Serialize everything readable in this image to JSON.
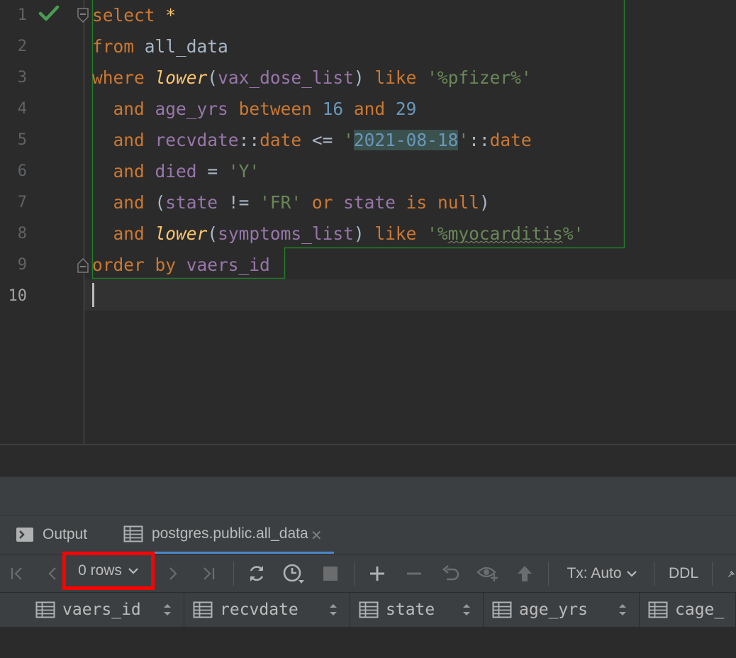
{
  "editor": {
    "line_numbers": [
      "1",
      "2",
      "3",
      "4",
      "5",
      "6",
      "7",
      "8",
      "9",
      "10"
    ],
    "lines": [
      [
        {
          "t": "select",
          "c": "kw"
        },
        {
          "t": " ",
          "c": "op"
        },
        {
          "t": "*",
          "c": "star"
        }
      ],
      [
        {
          "t": "from",
          "c": "kw"
        },
        {
          "t": " all_data",
          "c": "tbl"
        }
      ],
      [
        {
          "t": "where",
          "c": "kw"
        },
        {
          "t": " ",
          "c": "op"
        },
        {
          "t": "lower",
          "c": "fn"
        },
        {
          "t": "(",
          "c": "op"
        },
        {
          "t": "vax_dose_list",
          "c": "id"
        },
        {
          "t": ") ",
          "c": "op"
        },
        {
          "t": "like",
          "c": "kw"
        },
        {
          "t": " ",
          "c": "op"
        },
        {
          "t": "'%pfizer%'",
          "c": "str"
        }
      ],
      [
        {
          "t": "  ",
          "c": "op"
        },
        {
          "t": "and",
          "c": "kw"
        },
        {
          "t": " ",
          "c": "op"
        },
        {
          "t": "age_yrs",
          "c": "id"
        },
        {
          "t": " ",
          "c": "op"
        },
        {
          "t": "between",
          "c": "kw"
        },
        {
          "t": " ",
          "c": "op"
        },
        {
          "t": "16",
          "c": "num"
        },
        {
          "t": " ",
          "c": "op"
        },
        {
          "t": "and",
          "c": "kw"
        },
        {
          "t": " ",
          "c": "op"
        },
        {
          "t": "29",
          "c": "num"
        }
      ],
      [
        {
          "t": "  ",
          "c": "op"
        },
        {
          "t": "and",
          "c": "kw"
        },
        {
          "t": " ",
          "c": "op"
        },
        {
          "t": "recvdate",
          "c": "id"
        },
        {
          "t": "::",
          "c": "op"
        },
        {
          "t": "date",
          "c": "kw"
        },
        {
          "t": " <= ",
          "c": "op"
        },
        {
          "t": "'",
          "c": "str"
        },
        {
          "t": "2021-08-18",
          "c": "datehl"
        },
        {
          "t": "'",
          "c": "str"
        },
        {
          "t": "::",
          "c": "op"
        },
        {
          "t": "date",
          "c": "kw"
        }
      ],
      [
        {
          "t": "  ",
          "c": "op"
        },
        {
          "t": "and",
          "c": "kw"
        },
        {
          "t": " ",
          "c": "op"
        },
        {
          "t": "died",
          "c": "id"
        },
        {
          "t": " = ",
          "c": "op"
        },
        {
          "t": "'Y'",
          "c": "str"
        }
      ],
      [
        {
          "t": "  ",
          "c": "op"
        },
        {
          "t": "and",
          "c": "kw"
        },
        {
          "t": " (",
          "c": "op"
        },
        {
          "t": "state",
          "c": "id"
        },
        {
          "t": " != ",
          "c": "op"
        },
        {
          "t": "'FR'",
          "c": "str"
        },
        {
          "t": " ",
          "c": "op"
        },
        {
          "t": "or",
          "c": "kw"
        },
        {
          "t": " ",
          "c": "op"
        },
        {
          "t": "state",
          "c": "id"
        },
        {
          "t": " ",
          "c": "op"
        },
        {
          "t": "is",
          "c": "kw"
        },
        {
          "t": " ",
          "c": "op"
        },
        {
          "t": "null",
          "c": "kw"
        },
        {
          "t": ")",
          "c": "op"
        }
      ],
      [
        {
          "t": "  ",
          "c": "op"
        },
        {
          "t": "and",
          "c": "kw"
        },
        {
          "t": " ",
          "c": "op"
        },
        {
          "t": "lower",
          "c": "fn"
        },
        {
          "t": "(",
          "c": "op"
        },
        {
          "t": "symptoms_list",
          "c": "id"
        },
        {
          "t": ") ",
          "c": "op"
        },
        {
          "t": "like",
          "c": "kw"
        },
        {
          "t": " ",
          "c": "op"
        },
        {
          "t": "'%",
          "c": "str"
        },
        {
          "t": "myocarditis",
          "c": "str squig"
        },
        {
          "t": "%'",
          "c": "str"
        }
      ],
      [
        {
          "t": "order by",
          "c": "kw"
        },
        {
          "t": " ",
          "c": "op"
        },
        {
          "t": "vaers_id",
          "c": "id"
        }
      ],
      []
    ]
  },
  "tabs": {
    "output_label": "Output",
    "result_label": "postgres.public.all_data",
    "close_glyph": "✕"
  },
  "toolbar": {
    "rows_label": "0 rows",
    "tx_label": "Tx: Auto",
    "ddl_label": "DDL"
  },
  "columns": [
    "vaers_id",
    "recvdate",
    "state",
    "age_yrs",
    "cage_"
  ],
  "colors": {
    "accent": "#4a88c7",
    "highlight_border": "#ff0000",
    "success": "#499c54"
  }
}
